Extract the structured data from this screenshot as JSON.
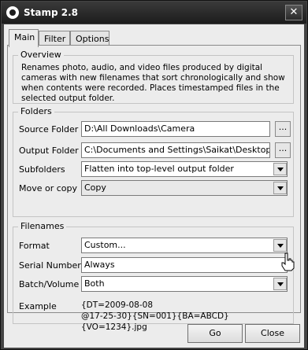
{
  "window": {
    "title": "Stamp 2.8",
    "close_glyph": "✕"
  },
  "tabs": [
    {
      "label": "Main"
    },
    {
      "label": "Filter"
    },
    {
      "label": "Options"
    }
  ],
  "overview": {
    "label": "Overview",
    "text": "Renames photo, audio, and video files produced by digital cameras with new filenames that sort chronologically and show when contents were recorded. Places timestamped files in the selected output folder."
  },
  "folders": {
    "label": "Folders",
    "source_label": "Source Folder",
    "source_value": "D:\\All Downloads\\Camera",
    "output_label": "Output Folder",
    "output_value": "C:\\Documents and Settings\\Saikat\\Desktop\\Stam",
    "subfolders_label": "Subfolders",
    "subfolders_value": "Flatten into top-level output folder",
    "move_label": "Move or copy",
    "move_value": "Copy",
    "browse_label": "..."
  },
  "filenames": {
    "label": "Filenames",
    "format_label": "Format",
    "format_value": "Custom...",
    "serial_label": "Serial Number",
    "serial_value": "Always",
    "batch_label": "Batch/Volume",
    "batch_value": "Both",
    "example_label": "Example",
    "example_line1": "{DT=2009-08-08",
    "example_line2": "@17-25-30}{SN=001}{BA=ABCD}{VO=1234}.jpg"
  },
  "buttons": {
    "go": "Go",
    "close": "Close"
  },
  "icons": {
    "app": "stamp-app-icon",
    "cursor": "hand-cursor-icon"
  }
}
